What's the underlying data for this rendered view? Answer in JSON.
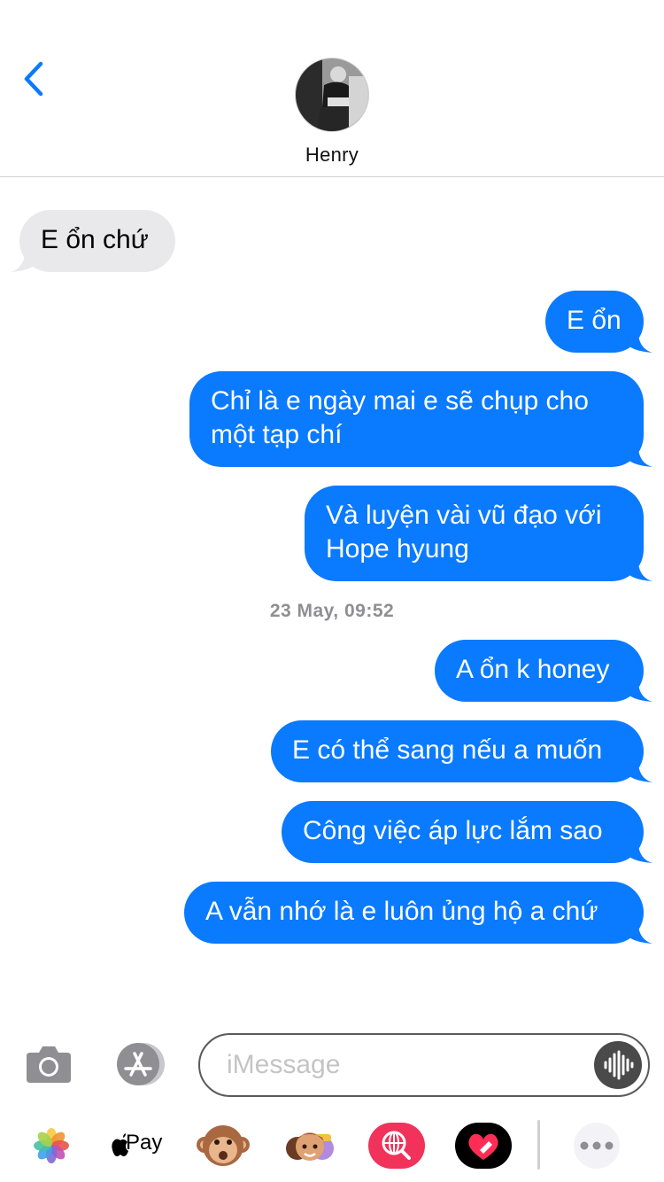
{
  "status_bar": {
    "battery_color": "#4cd964"
  },
  "header": {
    "back_icon": "chevron-left-icon",
    "contact_name": "Henry",
    "avatar_icon": "contact-photo"
  },
  "messages": [
    {
      "direction": "incoming",
      "lines": [
        "E ổn chứ"
      ]
    },
    {
      "direction": "outgoing",
      "lines": [
        "E ổn"
      ]
    },
    {
      "direction": "outgoing",
      "lines": [
        "Chỉ là e ngày mai e sẽ chụp cho",
        "một tạp chí"
      ]
    },
    {
      "direction": "outgoing",
      "lines": [
        "Và luyện vài vũ đạo với",
        "Hope hyung"
      ]
    },
    {
      "direction": "outgoing",
      "lines": [
        "A ổn k honey"
      ]
    },
    {
      "direction": "outgoing",
      "lines": [
        "E có thể sang nếu a muốn"
      ]
    },
    {
      "direction": "outgoing",
      "lines": [
        "Công việc áp lực lắm sao"
      ]
    },
    {
      "direction": "outgoing",
      "lines": [
        "A vẫn nhớ là e luôn ủng hộ a chứ"
      ]
    }
  ],
  "timestamp": "23 May, 09:52",
  "input_bar": {
    "placeholder": "iMessage",
    "value": "",
    "camera_icon": "camera-icon",
    "appstore_icon": "app-store-icon",
    "audio_icon": "audio-waveform-icon"
  },
  "app_drawer": {
    "apple_pay_label": "Pay",
    "items": [
      "photos-icon",
      "apple-pay-icon",
      "animoji-monkey-icon",
      "memoji-icon",
      "web-search-icon",
      "digital-touch-icon",
      "more-icon"
    ]
  },
  "colors": {
    "outgoing_bubble": "#0a7aff",
    "incoming_bubble": "#e9e9eb",
    "accent": "#0a7aff"
  }
}
